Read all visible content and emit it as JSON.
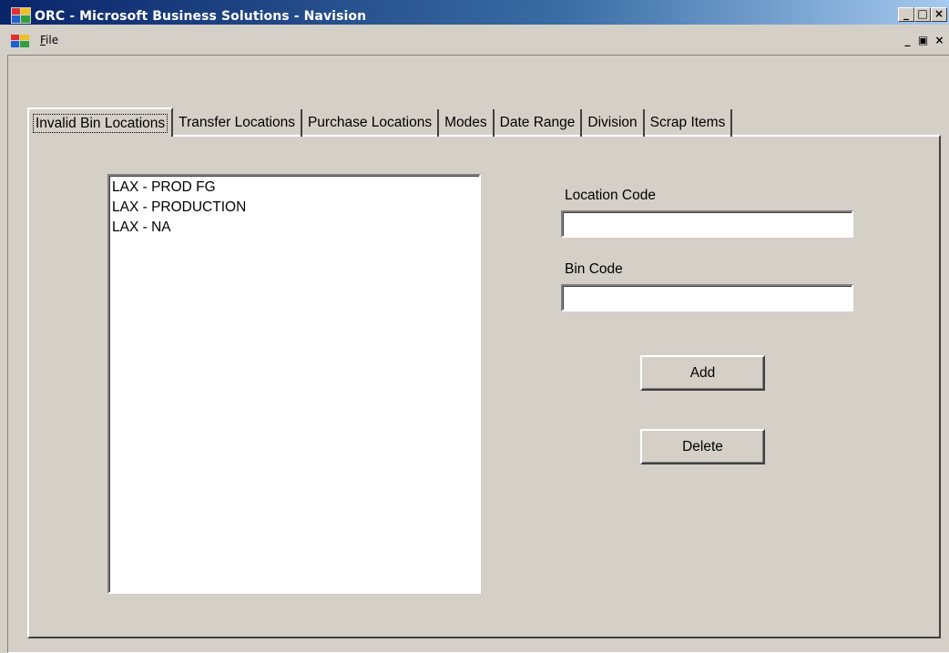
{
  "window": {
    "title": "ORC - Microsoft Business Solutions - Navision",
    "app_icon": "navision-app-icon",
    "caption_buttons": {
      "minimize": "_",
      "maximize": "□",
      "close": "×"
    }
  },
  "menubar": {
    "icon": "mdi-child-icon",
    "file": {
      "accel": "F",
      "rest": "ile"
    },
    "mdi_buttons": {
      "minimize": "_",
      "restore": "▣",
      "close": "×"
    }
  },
  "tabs": [
    {
      "label": "Invalid Bin Locations",
      "active": true
    },
    {
      "label": "Transfer Locations",
      "active": false
    },
    {
      "label": "Purchase Locations",
      "active": false
    },
    {
      "label": "Modes",
      "active": false
    },
    {
      "label": "Date Range",
      "active": false
    },
    {
      "label": "Division",
      "active": false
    },
    {
      "label": "Scrap Items",
      "active": false
    }
  ],
  "invalid_bin_locations": {
    "items": [
      "LAX - PROD FG",
      "LAX - PRODUCTION",
      "LAX - NA"
    ],
    "location_code_label": "Location Code",
    "location_code_value": "",
    "bin_code_label": "Bin Code",
    "bin_code_value": "",
    "add_button": "Add",
    "delete_button": "Delete"
  },
  "colors": {
    "title_gradient_start": "#0a246a",
    "title_gradient_end": "#a6caf0",
    "face": "#d4d0c8"
  }
}
